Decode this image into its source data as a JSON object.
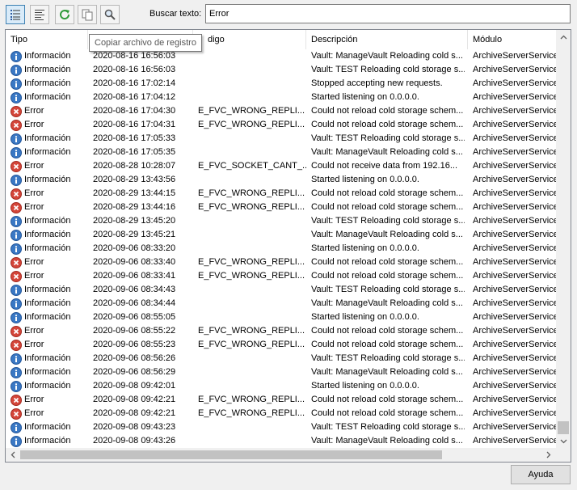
{
  "toolbar": {
    "buttons": [
      {
        "icon": "list-view-icon",
        "active": true
      },
      {
        "icon": "details-view-icon",
        "active": false
      },
      {
        "icon": "refresh-icon",
        "active": false
      },
      {
        "icon": "copy-icon",
        "active": false
      },
      {
        "icon": "search-icon",
        "active": false
      }
    ],
    "search_label": "Buscar texto:",
    "search_value": "Error"
  },
  "tooltip": "Copiar archivo de registro",
  "columns": {
    "tipo": "Tipo",
    "fecha": "",
    "codigo": "digo",
    "descripcion": "Descripción",
    "modulo": "Módulo"
  },
  "rows": [
    {
      "level": "info",
      "tipo": "Información",
      "fecha": "2020-08-16 16:56:03",
      "codigo": "",
      "descripcion": "Vault: ManageVault Reloading cold s...",
      "modulo": "ArchiveServerService"
    },
    {
      "level": "info",
      "tipo": "Información",
      "fecha": "2020-08-16 16:56:03",
      "codigo": "",
      "descripcion": "Vault: TEST Reloading cold storage s...",
      "modulo": "ArchiveServerService"
    },
    {
      "level": "info",
      "tipo": "Información",
      "fecha": "2020-08-16 17:02:14",
      "codigo": "",
      "descripcion": "Stopped accepting new requests.",
      "modulo": "ArchiveServerService"
    },
    {
      "level": "info",
      "tipo": "Información",
      "fecha": "2020-08-16 17:04:12",
      "codigo": "",
      "descripcion": "Started listening on 0.0.0.0.",
      "modulo": "ArchiveServerService"
    },
    {
      "level": "error",
      "tipo": "Error",
      "fecha": "2020-08-16 17:04:30",
      "codigo": "E_FVC_WRONG_REPLI...",
      "descripcion": "Could not reload cold storage schem...",
      "modulo": "ArchiveServerService"
    },
    {
      "level": "error",
      "tipo": "Error",
      "fecha": "2020-08-16 17:04:31",
      "codigo": "E_FVC_WRONG_REPLI...",
      "descripcion": "Could not reload cold storage schem...",
      "modulo": "ArchiveServerService"
    },
    {
      "level": "info",
      "tipo": "Información",
      "fecha": "2020-08-16 17:05:33",
      "codigo": "",
      "descripcion": "Vault: TEST Reloading cold storage s...",
      "modulo": "ArchiveServerService"
    },
    {
      "level": "info",
      "tipo": "Información",
      "fecha": "2020-08-16 17:05:35",
      "codigo": "",
      "descripcion": "Vault: ManageVault Reloading cold s...",
      "modulo": "ArchiveServerService"
    },
    {
      "level": "error",
      "tipo": "Error",
      "fecha": "2020-08-28 10:28:07",
      "codigo": "E_FVC_SOCKET_CANT_...",
      "descripcion": "Could not receive data from 192.16...",
      "modulo": "ArchiveServerService"
    },
    {
      "level": "info",
      "tipo": "Información",
      "fecha": "2020-08-29 13:43:56",
      "codigo": "",
      "descripcion": "Started listening on 0.0.0.0.",
      "modulo": "ArchiveServerService"
    },
    {
      "level": "error",
      "tipo": "Error",
      "fecha": "2020-08-29 13:44:15",
      "codigo": "E_FVC_WRONG_REPLI...",
      "descripcion": "Could not reload cold storage schem...",
      "modulo": "ArchiveServerService"
    },
    {
      "level": "error",
      "tipo": "Error",
      "fecha": "2020-08-29 13:44:16",
      "codigo": "E_FVC_WRONG_REPLI...",
      "descripcion": "Could not reload cold storage schem...",
      "modulo": "ArchiveServerService"
    },
    {
      "level": "info",
      "tipo": "Información",
      "fecha": "2020-08-29 13:45:20",
      "codigo": "",
      "descripcion": "Vault: TEST Reloading cold storage s...",
      "modulo": "ArchiveServerService"
    },
    {
      "level": "info",
      "tipo": "Información",
      "fecha": "2020-08-29 13:45:21",
      "codigo": "",
      "descripcion": "Vault: ManageVault Reloading cold s...",
      "modulo": "ArchiveServerService"
    },
    {
      "level": "info",
      "tipo": "Información",
      "fecha": "2020-09-06 08:33:20",
      "codigo": "",
      "descripcion": "Started listening on 0.0.0.0.",
      "modulo": "ArchiveServerService"
    },
    {
      "level": "error",
      "tipo": "Error",
      "fecha": "2020-09-06 08:33:40",
      "codigo": "E_FVC_WRONG_REPLI...",
      "descripcion": "Could not reload cold storage schem...",
      "modulo": "ArchiveServerService"
    },
    {
      "level": "error",
      "tipo": "Error",
      "fecha": "2020-09-06 08:33:41",
      "codigo": "E_FVC_WRONG_REPLI...",
      "descripcion": "Could not reload cold storage schem...",
      "modulo": "ArchiveServerService"
    },
    {
      "level": "info",
      "tipo": "Información",
      "fecha": "2020-09-06 08:34:43",
      "codigo": "",
      "descripcion": "Vault: TEST Reloading cold storage s...",
      "modulo": "ArchiveServerService"
    },
    {
      "level": "info",
      "tipo": "Información",
      "fecha": "2020-09-06 08:34:44",
      "codigo": "",
      "descripcion": "Vault: ManageVault Reloading cold s...",
      "modulo": "ArchiveServerService"
    },
    {
      "level": "info",
      "tipo": "Información",
      "fecha": "2020-09-06 08:55:05",
      "codigo": "",
      "descripcion": "Started listening on 0.0.0.0.",
      "modulo": "ArchiveServerService"
    },
    {
      "level": "error",
      "tipo": "Error",
      "fecha": "2020-09-06 08:55:22",
      "codigo": "E_FVC_WRONG_REPLI...",
      "descripcion": "Could not reload cold storage schem...",
      "modulo": "ArchiveServerService"
    },
    {
      "level": "error",
      "tipo": "Error",
      "fecha": "2020-09-06 08:55:23",
      "codigo": "E_FVC_WRONG_REPLI...",
      "descripcion": "Could not reload cold storage schem...",
      "modulo": "ArchiveServerService"
    },
    {
      "level": "info",
      "tipo": "Información",
      "fecha": "2020-09-06 08:56:26",
      "codigo": "",
      "descripcion": "Vault: TEST Reloading cold storage s...",
      "modulo": "ArchiveServerService"
    },
    {
      "level": "info",
      "tipo": "Información",
      "fecha": "2020-09-06 08:56:29",
      "codigo": "",
      "descripcion": "Vault: ManageVault Reloading cold s...",
      "modulo": "ArchiveServerService"
    },
    {
      "level": "info",
      "tipo": "Información",
      "fecha": "2020-09-08 09:42:01",
      "codigo": "",
      "descripcion": "Started listening on 0.0.0.0.",
      "modulo": "ArchiveServerService"
    },
    {
      "level": "error",
      "tipo": "Error",
      "fecha": "2020-09-08 09:42:21",
      "codigo": "E_FVC_WRONG_REPLI...",
      "descripcion": "Could not reload cold storage schem...",
      "modulo": "ArchiveServerService"
    },
    {
      "level": "error",
      "tipo": "Error",
      "fecha": "2020-09-08 09:42:21",
      "codigo": "E_FVC_WRONG_REPLI...",
      "descripcion": "Could not reload cold storage schem...",
      "modulo": "ArchiveServerService"
    },
    {
      "level": "info",
      "tipo": "Información",
      "fecha": "2020-09-08 09:43:23",
      "codigo": "",
      "descripcion": "Vault: TEST Reloading cold storage s...",
      "modulo": "ArchiveServerService"
    },
    {
      "level": "info",
      "tipo": "Información",
      "fecha": "2020-09-08 09:43:26",
      "codigo": "",
      "descripcion": "Vault: ManageVault Reloading cold s...",
      "modulo": "ArchiveServerService"
    }
  ],
  "help_button": "Ayuda",
  "colors": {
    "info": "#3a78c4",
    "error": "#d4463a",
    "accent": "#3c7fb1"
  }
}
